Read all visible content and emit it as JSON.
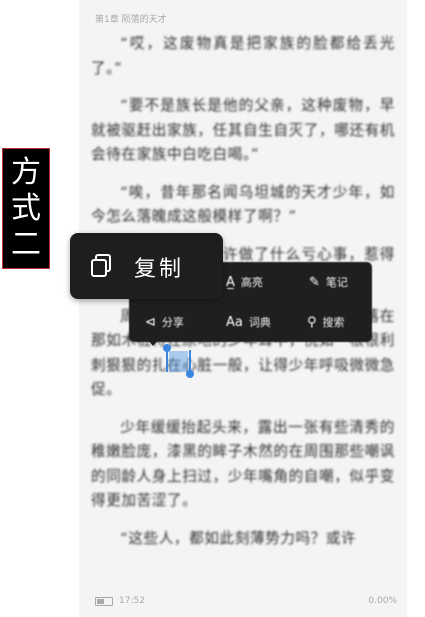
{
  "reader": {
    "chapter_title": "第1章 陨落的天才",
    "paragraphs": [
      "“哎，这废物真是把家族的脸都给丢光了。”",
      "“要不是族长是他的父亲，这种废物，早就被驱赶出家族，任其自生自灭了，哪还有机会待在家族中白吃白喝。”",
      "“唉，昔年那名闻乌坦城的天才少年，如今怎么落魄成这般模样了啊？”",
      "“谁知道呢，或许做了什么亏心事，惹得神灵降怒了吧……”",
      "周围传来的不屑嘲笑以及惋惜轻叹，落在那如木桩待在原地的少年耳中，恍如一根根利刺狠狠的扎在心脏一般，让得少年呼吸微微急促。",
      "少年缓缓抬起头来，露出一张有些清秀的稚嫩脸庞，漆黑的眸子木然的在周围那些嘲讽的同龄人身上扫过，少年嘴角的自嘲，似乎变得更加苦涩了。",
      "“这些人，都如此刻薄势力吗？或许"
    ],
    "time": "17:52",
    "progress": "0.00%"
  },
  "selection_menu": {
    "highlight_label": "高亮",
    "note_label": "笔记",
    "share_label": "分享",
    "dictionary_label": "词典",
    "search_label": "搜索"
  },
  "copy_popup": {
    "label": "复制"
  },
  "side_label": {
    "chars": [
      "方",
      "式",
      "二"
    ]
  },
  "colors": {
    "menu_bg": "#1f1f1f",
    "selection": "#3b86e0",
    "page_bg": "#f4f4f4"
  }
}
